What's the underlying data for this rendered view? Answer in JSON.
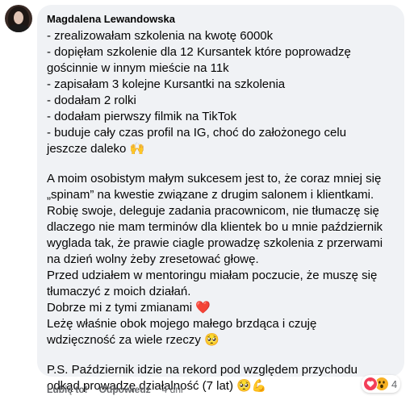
{
  "comment": {
    "author": "Magdalena Lewandowska",
    "paragraphs": [
      [
        "- zrealizowałam szkolenia na kwotę 6000k",
        "- dopięłam szkolenie dla 12 Kursantek które poprowadzę",
        "gościnnie w innym mieście na 11k",
        "- zapisałam 3 kolejne Kursantki na szkolenia",
        "- dodałam 2 rolki",
        "- dodałam pierwszy filmik na TikTok",
        "- buduje cały czas profil na IG, choć do założonego celu",
        "jeszcze daleko 🙌"
      ],
      [
        "A moim osobistym małym sukcesem jest to, że coraz mniej się",
        "„spinam” na kwestie związane z drugim salonem i klientkami.",
        "Robię swoje, deleguje zadania pracownicom, nie tłumaczę się",
        "dlaczego nie mam terminów dla klientek bo u mnie październik",
        "wyglada tak, że prawie ciagle prowadzę szkolenia z przerwami",
        "na dzień wolny żeby zresetować głowę.",
        "Przed udziałem w mentoringu miałam poczucie, że muszę się",
        "tłumaczyć z moich działań.",
        "Dobrze mi z tymi zmianami ❤️",
        "Leżę właśnie obok mojego małego brzdąca i czuję",
        "wdzięczność za wiele rzeczy 🥺"
      ],
      [
        "P.S. Październik idzie na rekord pod względem przychodu",
        "odkąd prowadzę działalność (7 lat) 🥺💪"
      ]
    ]
  },
  "reactions": {
    "icons": [
      "love-icon",
      "wow-icon"
    ],
    "count": "4",
    "colors": {
      "love": "#f33e58",
      "wow": "#f7b125"
    }
  },
  "actions": {
    "like_label": "Lubię to!",
    "reply_label": "Odpowiedz",
    "timestamp": "4 dni"
  },
  "colors": {
    "bubble_bg": "#f0f2f5",
    "text": "#050505",
    "secondary": "#65676b"
  }
}
